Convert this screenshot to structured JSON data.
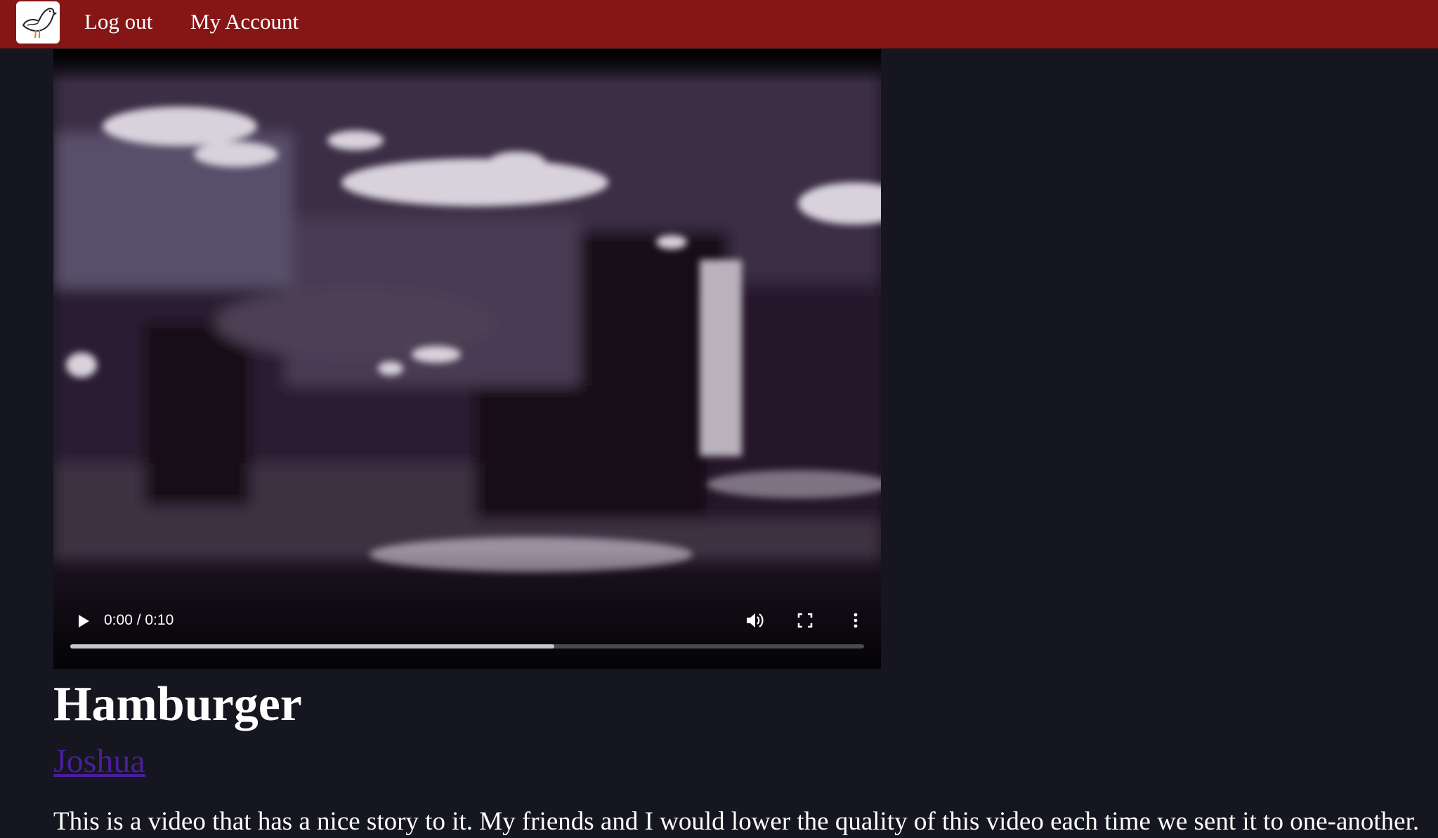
{
  "nav": {
    "logout_label": "Log out",
    "account_label": "My Account"
  },
  "video": {
    "time_display": "0:00 / 0:10",
    "buffered_fraction": 0.61
  },
  "post": {
    "title": "Hamburger",
    "author": "Joshua",
    "description": "This is a video that has a nice story to it. My friends and I would lower the quality of this video each time we sent it to one-another."
  },
  "colors": {
    "topbar": "#861616",
    "page_background": "#15161f",
    "author_link": "#4b1d9a"
  },
  "icons": [
    "bird-logo-icon",
    "play-icon",
    "volume-icon",
    "fullscreen-icon",
    "more-options-icon"
  ]
}
